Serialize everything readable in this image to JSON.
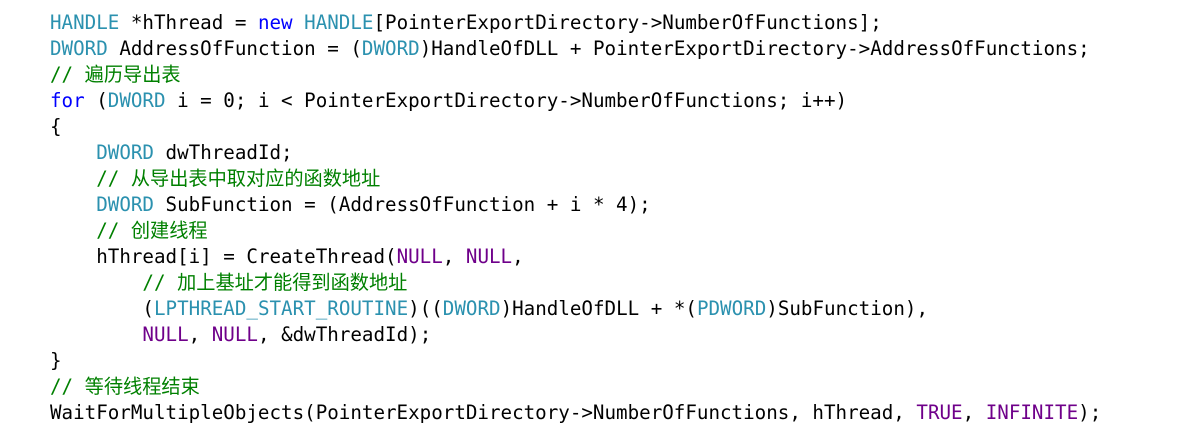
{
  "colors": {
    "background": "#ffffff",
    "plain": "#000000",
    "keyword": "#0000ff",
    "type": "#2b91af",
    "macro": "#6f008a",
    "comment": "#008000"
  },
  "code": {
    "lines": [
      {
        "indent": "",
        "tokens": [
          {
            "t": "HANDLE",
            "k": "type"
          },
          {
            "t": " *hThread = ",
            "k": "pl"
          },
          {
            "t": "new",
            "k": "kw"
          },
          {
            "t": " ",
            "k": "pl"
          },
          {
            "t": "HANDLE",
            "k": "type"
          },
          {
            "t": "[PointerExportDirectory->NumberOfFunctions];",
            "k": "pl"
          }
        ]
      },
      {
        "indent": "",
        "tokens": [
          {
            "t": "DWORD",
            "k": "type"
          },
          {
            "t": " AddressOfFunction = (",
            "k": "pl"
          },
          {
            "t": "DWORD",
            "k": "type"
          },
          {
            "t": ")HandleOfDLL + PointerExportDirectory->AddressOfFunctions;",
            "k": "pl"
          }
        ]
      },
      {
        "indent": "",
        "tokens": [
          {
            "t": "// 遍历导出表",
            "k": "cm"
          }
        ]
      },
      {
        "indent": "",
        "tokens": [
          {
            "t": "for",
            "k": "kw"
          },
          {
            "t": " (",
            "k": "pl"
          },
          {
            "t": "DWORD",
            "k": "type"
          },
          {
            "t": " i = 0; i < PointerExportDirectory->NumberOfFunctions; i++)",
            "k": "pl"
          }
        ]
      },
      {
        "indent": "",
        "tokens": [
          {
            "t": "{",
            "k": "pl"
          }
        ]
      },
      {
        "indent": "    ",
        "tokens": [
          {
            "t": "DWORD",
            "k": "type"
          },
          {
            "t": " dwThreadId;",
            "k": "pl"
          }
        ]
      },
      {
        "indent": "    ",
        "tokens": [
          {
            "t": "// 从导出表中取对应的函数地址",
            "k": "cm"
          }
        ]
      },
      {
        "indent": "    ",
        "tokens": [
          {
            "t": "DWORD",
            "k": "type"
          },
          {
            "t": " SubFunction = (AddressOfFunction + i * 4);",
            "k": "pl"
          }
        ]
      },
      {
        "indent": "    ",
        "tokens": [
          {
            "t": "// 创建线程",
            "k": "cm"
          }
        ]
      },
      {
        "indent": "    ",
        "tokens": [
          {
            "t": "hThread[i] = CreateThread(",
            "k": "pl"
          },
          {
            "t": "NULL",
            "k": "macro"
          },
          {
            "t": ", ",
            "k": "pl"
          },
          {
            "t": "NULL",
            "k": "macro"
          },
          {
            "t": ",",
            "k": "pl"
          }
        ]
      },
      {
        "indent": "        ",
        "tokens": [
          {
            "t": "// 加上基址才能得到函数地址",
            "k": "cm"
          }
        ]
      },
      {
        "indent": "        ",
        "tokens": [
          {
            "t": "(",
            "k": "pl"
          },
          {
            "t": "LPTHREAD_START_ROUTINE",
            "k": "type"
          },
          {
            "t": ")((",
            "k": "pl"
          },
          {
            "t": "DWORD",
            "k": "type"
          },
          {
            "t": ")HandleOfDLL + *(",
            "k": "pl"
          },
          {
            "t": "PDWORD",
            "k": "type"
          },
          {
            "t": ")SubFunction),",
            "k": "pl"
          }
        ]
      },
      {
        "indent": "        ",
        "tokens": [
          {
            "t": "NULL",
            "k": "macro"
          },
          {
            "t": ", ",
            "k": "pl"
          },
          {
            "t": "NULL",
            "k": "macro"
          },
          {
            "t": ", &dwThreadId);",
            "k": "pl"
          }
        ]
      },
      {
        "indent": "",
        "tokens": [
          {
            "t": "}",
            "k": "pl"
          }
        ]
      },
      {
        "indent": "",
        "tokens": [
          {
            "t": "// 等待线程结束",
            "k": "cm"
          }
        ]
      },
      {
        "indent": "",
        "tokens": [
          {
            "t": "WaitForMultipleObjects(PointerExportDirectory->NumberOfFunctions, hThread, ",
            "k": "pl"
          },
          {
            "t": "TRUE",
            "k": "macro"
          },
          {
            "t": ", ",
            "k": "pl"
          },
          {
            "t": "INFINITE",
            "k": "macro"
          },
          {
            "t": ");",
            "k": "pl"
          }
        ]
      }
    ]
  }
}
